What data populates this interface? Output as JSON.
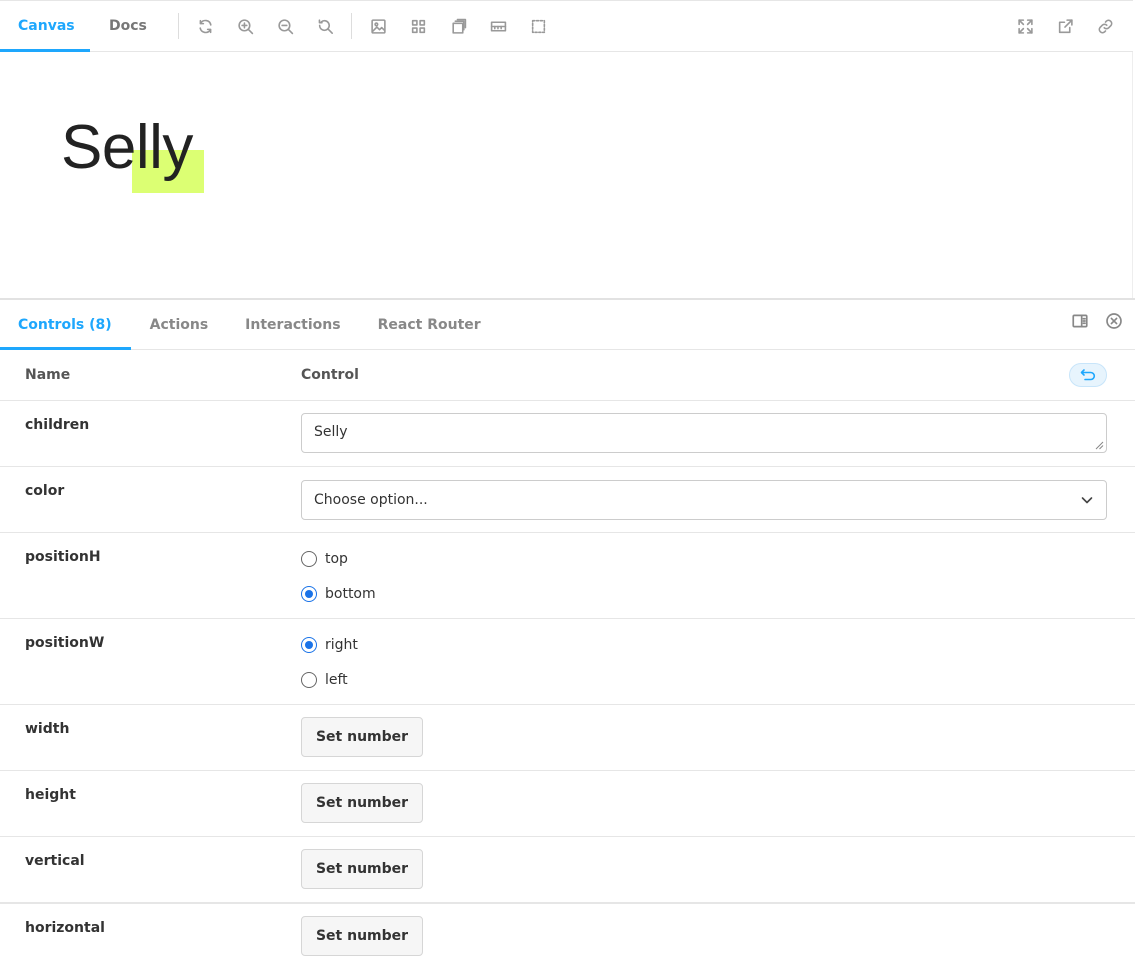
{
  "toolbar": {
    "tabs": [
      {
        "label": "Canvas",
        "active": true
      },
      {
        "label": "Docs",
        "active": false
      }
    ],
    "left_icons": [
      "reload-icon",
      "zoom-in-icon",
      "zoom-out-icon",
      "zoom-reset-icon",
      "background-icon",
      "grid-icon",
      "viewport-icon",
      "measure-icon",
      "outline-icon"
    ],
    "right_icons": [
      "fullscreen-icon",
      "open-new-tab-icon",
      "copy-link-icon"
    ]
  },
  "preview": {
    "text": "Selly",
    "highlight_color": "#dcff73"
  },
  "addons": {
    "tabs": [
      {
        "label": "Controls (8)",
        "active": true
      },
      {
        "label": "Actions",
        "active": false
      },
      {
        "label": "Interactions",
        "active": false
      },
      {
        "label": "React Router",
        "active": false
      }
    ],
    "right_icons": [
      "panel-orientation-icon",
      "close-panel-icon"
    ]
  },
  "controls": {
    "header": {
      "name": "Name",
      "control": "Control"
    },
    "children": {
      "name": "children",
      "value": "Selly"
    },
    "color": {
      "name": "color",
      "placeholder": "Choose option..."
    },
    "positionH": {
      "name": "positionH",
      "options": [
        "top",
        "bottom"
      ],
      "selected": "bottom"
    },
    "positionW": {
      "name": "positionW",
      "options": [
        "right",
        "left"
      ],
      "selected": "right"
    },
    "width": {
      "name": "width",
      "button": "Set number"
    },
    "height": {
      "name": "height",
      "button": "Set number"
    },
    "vertical": {
      "name": "vertical",
      "button": "Set number"
    },
    "horizontal": {
      "name": "horizontal",
      "button": "Set number"
    }
  },
  "colors": {
    "accent": "#1ea7fd",
    "radio_checked": "#1a73e8"
  }
}
